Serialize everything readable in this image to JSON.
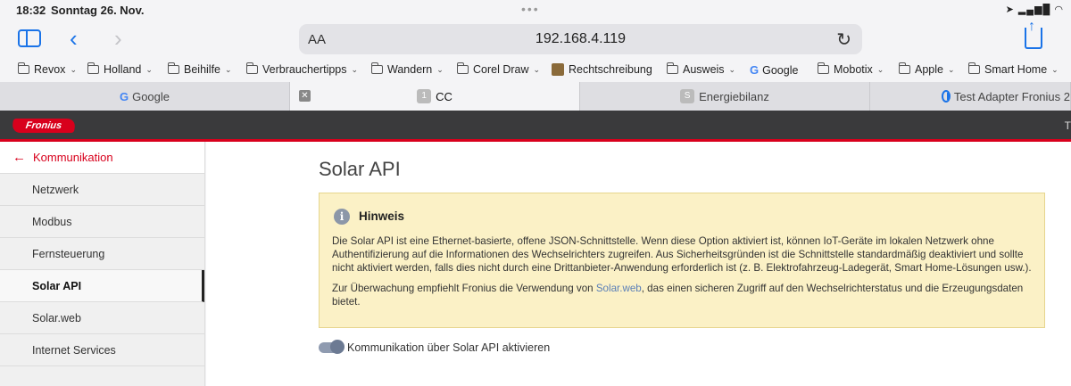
{
  "status": {
    "time": "18:32",
    "date": "Sonntag 26. Nov."
  },
  "toolbar": {
    "text_size": "AA",
    "url": "192.168.4.119"
  },
  "bookmarks": [
    {
      "label": "Revox",
      "type": "folder"
    },
    {
      "label": "Holland",
      "type": "folder"
    },
    {
      "label": "Beihilfe",
      "type": "folder"
    },
    {
      "label": "Verbrauchertipps",
      "type": "folder"
    },
    {
      "label": "Wandern",
      "type": "folder"
    },
    {
      "label": "Corel Draw",
      "type": "folder"
    },
    {
      "label": "Rechtschreibung",
      "type": "link"
    },
    {
      "label": "Ausweis",
      "type": "folder"
    },
    {
      "label": "Google",
      "type": "link"
    },
    {
      "label": "Mobotix",
      "type": "folder"
    },
    {
      "label": "Apple",
      "type": "folder"
    },
    {
      "label": "Smart Home",
      "type": "folder"
    }
  ],
  "tabs": [
    {
      "label": "Google",
      "icon": "google-icon"
    },
    {
      "label": "CC",
      "badge": "1",
      "active": true
    },
    {
      "label": "Energiebilanz",
      "badge": "S"
    },
    {
      "label": "Test Adapter Fronius 2",
      "icon": "info-icon"
    }
  ],
  "header": {
    "logo": "Fronius",
    "right_text": "T"
  },
  "nav": {
    "back_label": "Kommunikation",
    "items": [
      "Netzwerk",
      "Modbus",
      "Fernsteuerung",
      "Solar API",
      "Solar.web",
      "Internet Services"
    ],
    "active": "Solar API"
  },
  "main": {
    "title": "Solar API",
    "hint_title": "Hinweis",
    "hint_p1": "Die Solar API ist eine Ethernet-basierte, offene JSON-Schnittstelle. Wenn diese Option aktiviert ist, können IoT-Geräte im lokalen Netzwerk ohne Authentifizierung auf die Informationen des Wechselrichters zugreifen. Aus Sicherheitsgründen ist die Schnittstelle standardmäßig deaktiviert und sollte nicht aktiviert werden, falls dies nicht durch eine Drittanbieter-Anwendung erforderlich ist (z. B. Elektrofahrzeug-Ladegerät, Smart Home-Lösungen usw.).",
    "hint_p2_before": "Zur Überwachung empfiehlt Fronius die Verwendung von ",
    "hint_p2_link": "Solar.web",
    "hint_p2_after": ", das einen sicheren Zugriff auf den Wechselrichterstatus und die Erzeugungsdaten bietet.",
    "toggle_label": "Kommunikation über Solar API aktivieren",
    "toggle_on": true
  }
}
